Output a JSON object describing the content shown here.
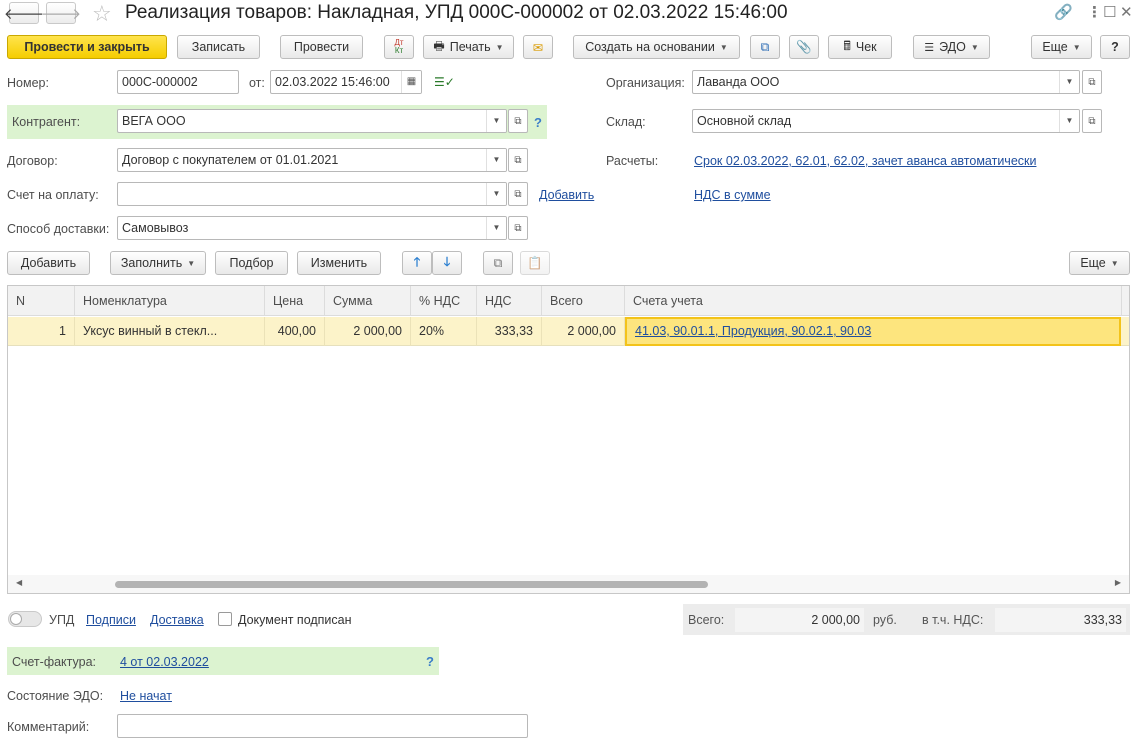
{
  "window": {
    "title": "Реализация товаров: Накладная, УПД 000С-000002 от 02.03.2022 15:46:00"
  },
  "toolbar": {
    "post_close": "Провести и закрыть",
    "save": "Записать",
    "post": "Провести",
    "dtkt": "Ат Кт",
    "print": "Печать",
    "create_based": "Создать на основании",
    "check": "Чек",
    "edo": "ЭДО",
    "more": "Еще",
    "help": "?"
  },
  "form": {
    "number_label": "Номер:",
    "number_value": "000С-000002",
    "from_label": "от:",
    "date_value": "02.03.2022 15:46:00",
    "org_label": "Организация:",
    "org_value": "Лаванда ООО",
    "counterparty_label": "Контрагент:",
    "counterparty_value": "ВЕГА ООО",
    "counterparty_help": "?",
    "warehouse_label": "Склад:",
    "warehouse_value": "Основной склад",
    "contract_label": "Договор:",
    "contract_value": "Договор с покупателем от 01.01.2021",
    "settlements_label": "Расчеты:",
    "settlements_link": "Срок 02.03.2022, 62.01, 62.02, зачет аванса автоматически",
    "invoice_label": "Счет на оплату:",
    "invoice_value": "",
    "invoice_add": "Добавить",
    "vat_link": "НДС в сумме",
    "delivery_label": "Способ доставки:",
    "delivery_value": "Самовывоз"
  },
  "table_toolbar": {
    "add": "Добавить",
    "fill": "Заполнить",
    "select": "Подбор",
    "change": "Изменить",
    "more": "Еще"
  },
  "table": {
    "headers": [
      "N",
      "Номенклатура",
      "Цена",
      "Сумма",
      "% НДС",
      "НДС",
      "Всего",
      "Счета учета"
    ],
    "rows": [
      {
        "n": "1",
        "item": "Уксус винный в стекл...",
        "price": "400,00",
        "sum": "2 000,00",
        "vat_rate": "20%",
        "vat": "333,33",
        "total": "2 000,00",
        "accounts": "41.03, 90.01.1, Продукция, 90.02.1, 90.03"
      }
    ]
  },
  "footer": {
    "upd_label": "УПД",
    "signatures_link": "Подписи",
    "delivery_link": "Доставка",
    "signed_label": "Документ подписан",
    "total_label": "Всего:",
    "total_value": "2 000,00",
    "currency": "руб.",
    "vat_label": "в т.ч. НДС:",
    "vat_value": "333,33",
    "invoice_label": "Счет-фактура:",
    "invoice_link": "4 от 02.03.2022",
    "invoice_help": "?",
    "edo_state_label": "Состояние ЭДО:",
    "edo_state_link": "Не начат",
    "comment_label": "Комментарий:",
    "comment_value": ""
  },
  "colors": {
    "primary_button": "#f5cd00",
    "green_band": "#dcf3d0",
    "selected_row": "#fcf3c9",
    "link": "#1f4e9e"
  }
}
